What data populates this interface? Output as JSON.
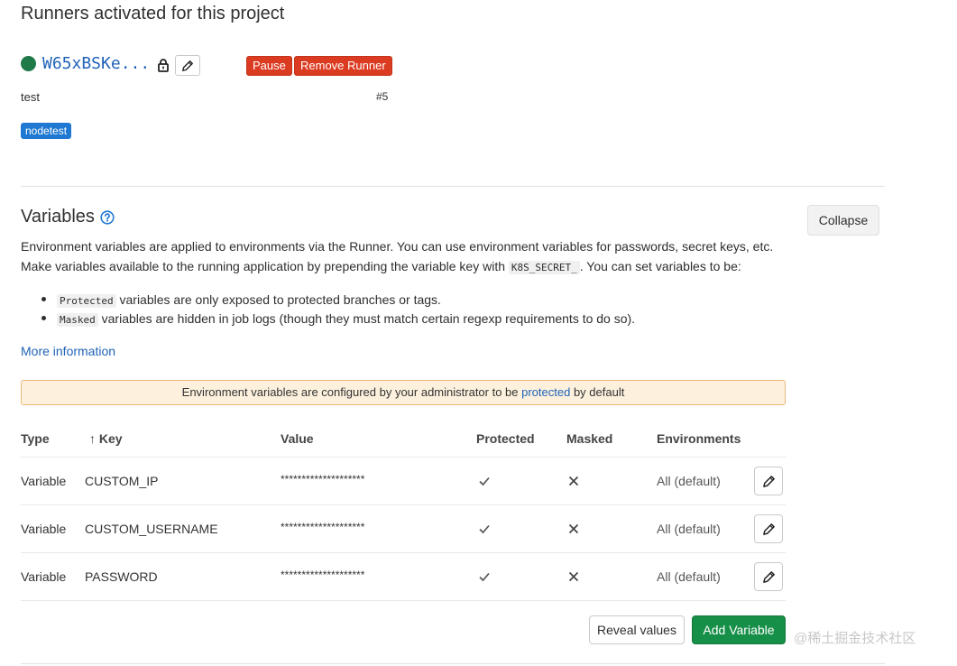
{
  "runners": {
    "title": "Runners activated for this project",
    "runner": {
      "token": "W65xBSKe...",
      "description": "test",
      "id": "#5",
      "tag": "nodetest",
      "pause_label": "Pause",
      "remove_label": "Remove Runner",
      "status_color": "#1f7a4a"
    }
  },
  "variables": {
    "title": "Variables",
    "collapse_label": "Collapse",
    "desc_line1": "Environment variables are applied to environments via the Runner. You can use environment variables for passwords, secret keys, etc.",
    "desc_line2_pre": "Make variables available to the running application by prepending the variable key with ",
    "desc_line2_code": "K8S_SECRET_",
    "desc_line2_post": ". You can set variables to be:",
    "bullets": [
      {
        "code": "Protected",
        "text": " variables are only exposed to protected branches or tags."
      },
      {
        "code": "Masked",
        "text": " variables are hidden in job logs (though they must match certain regexp requirements to do so)."
      }
    ],
    "more_info": "More information",
    "notice_pre": "Environment variables are configured by your administrator to be ",
    "notice_link": "protected",
    "notice_post": " by default",
    "table": {
      "headers": {
        "type": "Type",
        "key": "↑ Key",
        "value": "Value",
        "protected": "Protected",
        "masked": "Masked",
        "environments": "Environments"
      },
      "rows": [
        {
          "type": "Variable",
          "key": "CUSTOM_IP",
          "value": "********************",
          "protected": true,
          "masked": false,
          "environments": "All (default)"
        },
        {
          "type": "Variable",
          "key": "CUSTOM_USERNAME",
          "value": "********************",
          "protected": true,
          "masked": false,
          "environments": "All (default)"
        },
        {
          "type": "Variable",
          "key": "PASSWORD",
          "value": "********************",
          "protected": true,
          "masked": false,
          "environments": "All (default)"
        }
      ]
    },
    "reveal_label": "Reveal values",
    "add_label": "Add Variable"
  },
  "watermark": "@稀土掘金技术社区",
  "colors": {
    "danger": "#db3b21",
    "success": "#168f48",
    "link": "#1f63b8",
    "tag": "#1f78d1",
    "notice_bg": "#fdf1dd"
  }
}
